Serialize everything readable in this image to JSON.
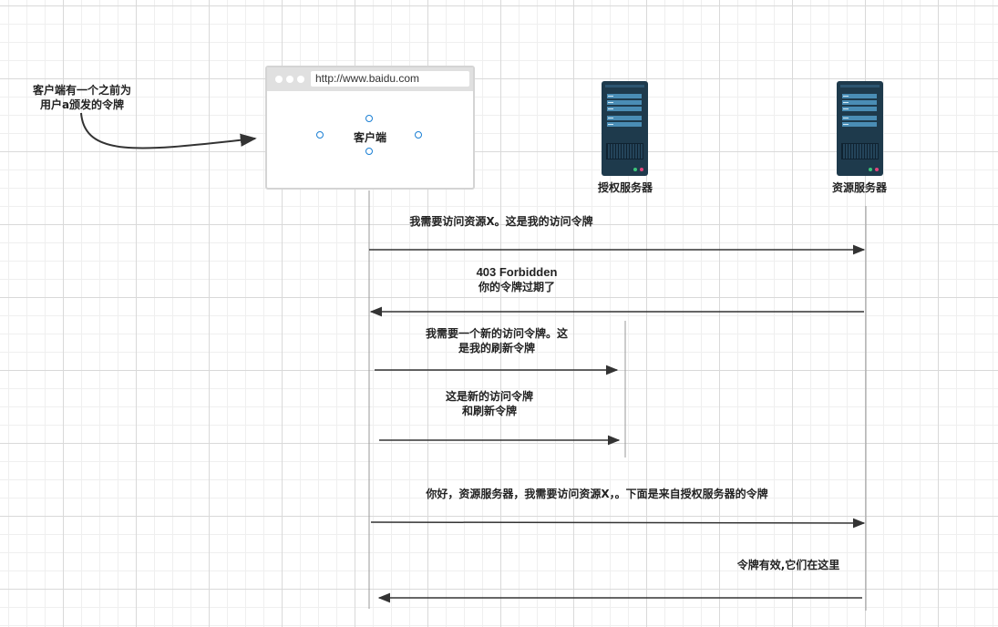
{
  "note": {
    "line1": "客户端有一个之前为",
    "line2": "用户a颁发的令牌"
  },
  "client": {
    "url": "http://www.baidu.com",
    "label": "客户端"
  },
  "auth_server": {
    "label": "授权服务器"
  },
  "resource_server": {
    "label": "资源服务器"
  },
  "messages": {
    "m1": "我需要访问资源X。这是我的访问令牌",
    "m2_line1": "403 Forbidden",
    "m2_line2": "你的令牌过期了",
    "m3_line1": "我需要一个新的访问令牌。这",
    "m3_line2": "是我的刷新令牌",
    "m4_line1": "这是新的访问令牌",
    "m4_line2": "和刷新令牌",
    "m5": "你好，资源服务器，我需要访问资源X，。下面是来自授权服务器的令牌",
    "m6": "令牌有效,它们在这里"
  },
  "colors": {
    "server_body": "#1e3a4c",
    "server_slot": "#4a8db5",
    "arrow": "#333333",
    "lifeline": "#999999",
    "handle": "#1a7fd4"
  }
}
